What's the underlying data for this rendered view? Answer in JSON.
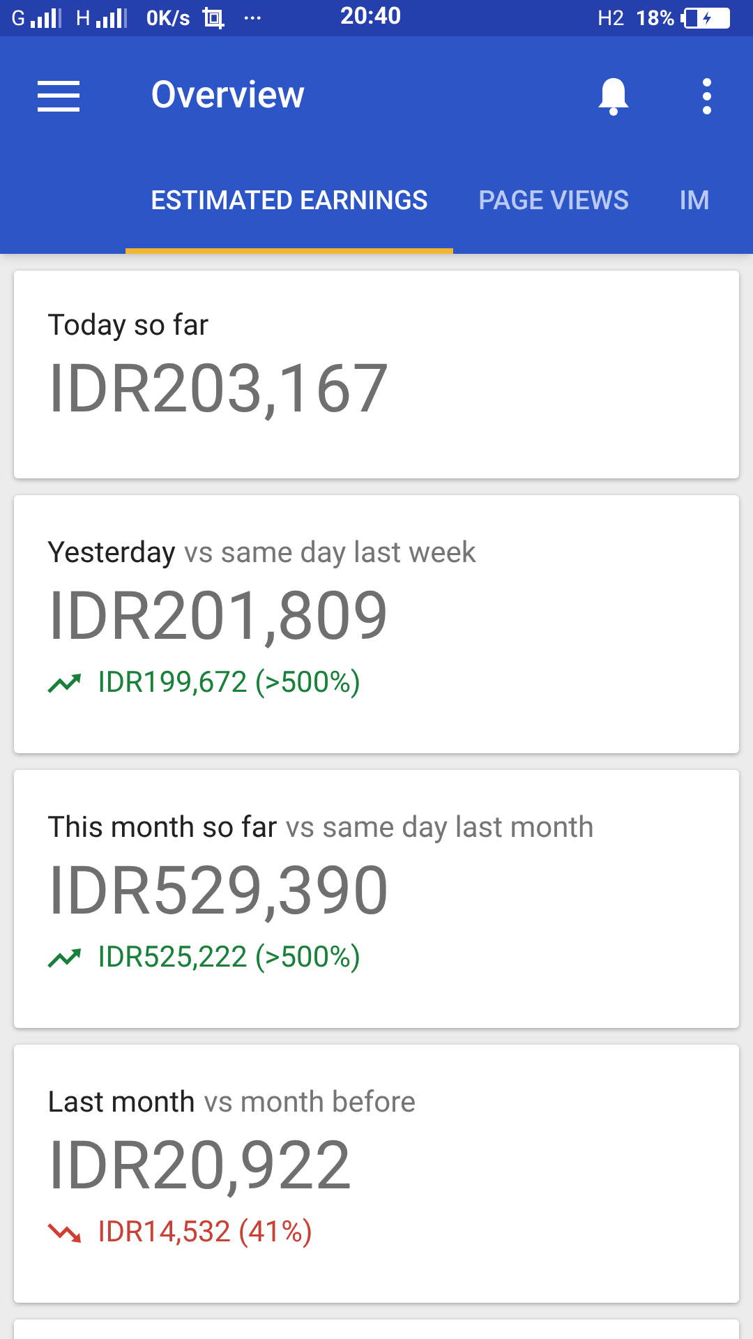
{
  "status_bar": {
    "network_1": "G",
    "network_2": "H",
    "speed": "0K/s",
    "more": "···",
    "time": "20:40",
    "network_3": "H2",
    "battery": "18%"
  },
  "app_bar": {
    "title": "Overview"
  },
  "tabs": [
    {
      "label": "ESTIMATED EARNINGS",
      "selected": true
    },
    {
      "label": "PAGE VIEWS",
      "selected": false
    },
    {
      "label": "IM",
      "selected": false
    }
  ],
  "cards": [
    {
      "label": "Today so far",
      "amount": "IDR203,167"
    },
    {
      "label": "Yesterday",
      "comparison": "vs same day last week",
      "amount": "IDR201,809",
      "change": {
        "kind": "up",
        "text": "IDR199,672 (>500%)"
      }
    },
    {
      "label": "This month so far",
      "comparison": "vs same day last month",
      "amount": "IDR529,390",
      "change": {
        "kind": "up",
        "text": "IDR525,222 (>500%)"
      }
    },
    {
      "label": "Last month",
      "comparison": "vs month before",
      "amount": "IDR20,922",
      "change": {
        "kind": "down",
        "text": "IDR14,532 (41%)"
      }
    }
  ]
}
